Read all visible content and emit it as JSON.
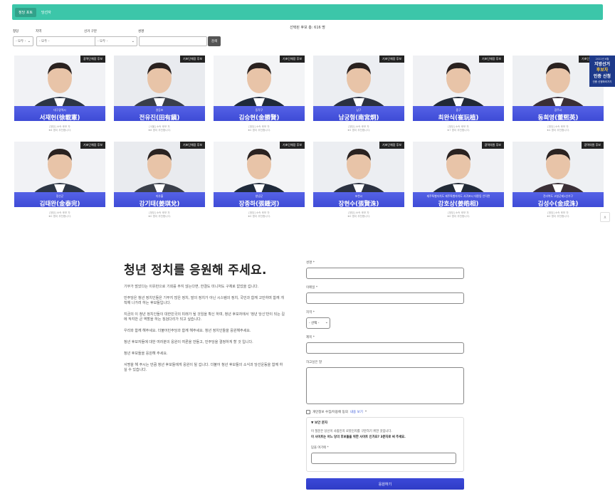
{
  "tabs": [
    {
      "label": "정당 포토",
      "active": true
    },
    {
      "label": "당선자",
      "active": false
    }
  ],
  "summary": "선택된 후보 총: 616 명",
  "filters": {
    "party_label": "정당",
    "region_label": "지역",
    "district_label": "선거 구분",
    "name_label": "성명",
    "party_value": "- 모두 -",
    "region_value": "- 모두 -",
    "district_value": "- 모두 -",
    "search_label": "검색"
  },
  "candidates": [
    {
      "badge": "광역단체장 후보",
      "region": "대구광역시",
      "name": "서재헌(徐載憲)",
      "meta1": "[정당] 소속 후보 자",
      "meta2": "★6 명이 추천합니다."
    },
    {
      "badge": "기초단체장 후보",
      "region": "영등포",
      "name": "전유진(田有鎭)",
      "meta1": "[서울] 소속 후보 자",
      "meta2": "★8 명이 추천합니다."
    },
    {
      "badge": "기초단체장 후보",
      "region": "동작구",
      "name": "김승현(金勝賢)",
      "meta1": "[정당] 소속 후보 자",
      "meta2": "★0 명이 추천합니다."
    },
    {
      "badge": "기초단체장 후보",
      "region": "남구",
      "name": "남궁형(南宮炯)",
      "meta1": "[정당] 소속 후보 자",
      "meta2": "★5 명이 추천합니다."
    },
    {
      "badge": "기초단체장 후보",
      "region": "중구",
      "name": "최완식(崔玩植)",
      "meta1": "[정당] 소속 후보 자",
      "meta2": "★7 명이 추천합니다."
    },
    {
      "badge": "기초단체장 후보",
      "region": "광주시",
      "name": "동희영(董熙英)",
      "meta1": "[정당] 소속 후보 자",
      "meta2": "★4 명이 추천합니다."
    },
    {
      "badge": "기초단체장 후보",
      "region": "정선군",
      "name": "김태완(金泰完)",
      "meta1": "[정당] 소속 후보 자",
      "meta2": "★0 명이 추천합니다."
    },
    {
      "badge": "기초단체장 후보",
      "region": "미추홀",
      "name": "강기태(姜琪兌)",
      "meta1": "[정당] 소속 후보 자",
      "meta2": "★0 명이 추천합니다."
    },
    {
      "badge": "기초단체장 후보",
      "region": "창녕군",
      "name": "장종하(張鍾河)",
      "meta1": "[정당] 소속 후보 자",
      "meta2": "★0 명이 추천합니다."
    },
    {
      "badge": "기초단체장 후보",
      "region": "포천시",
      "name": "장현수(張賢洙)",
      "meta1": "[정당] 소속 후보 자",
      "meta2": "★0 명이 추천합니다."
    },
    {
      "badge": "광역의원 후보",
      "region": "제주특별자치도 제주특별자치도 서귀포시 대륜동 안덕면",
      "name": "강호상(姜皓相)",
      "meta1": "[정당] 소속 후보 자",
      "meta2": "★0 명이 추천합니다."
    },
    {
      "badge": "광역의원 후보",
      "region": "전라북도 고창군제1선거구",
      "name": "김성수(金成洙)",
      "meta1": "[정당] 소속 후보 자",
      "meta2": "★0 명이 추천합니다."
    }
  ],
  "banner": {
    "top": "2022년 6월",
    "line1": "지방선거",
    "line2": "후보자",
    "line3": "인증 신청",
    "bottom": "인증 신청하러가기"
  },
  "scroll_top_label": "∧",
  "appeal": {
    "title": "청년 정치를 응원해 주세요.",
    "paragraphs": [
      "기부가 많았다는 이유만으로 기회를 주지 않는다면, 한결도 미니처도 구체로 없었을 겁니다.",
      "민주당은 청년 정치인들은 기부지 많은 정치, 말의 정치가 아닌 시스템의 정치, 국민과 함께 고민하며 함께 개척해 나가려 하는 후보들입니다.",
      "지금의 이 청년 정치인들이 대한민국의 미래가 될 것임을 확신 하며, 청년 후보자에서 '청년 당신'만이 되는 길에 작지만 큰 역할을 하는 징검다리가 되고 싶습니다.",
      "우리와 함께 해주세요. 더불어민주당과 함께 해주세요. 청년 정치인들을 응원해주세요.",
      "청년 후보자들에 대한 여러분의 응원이 여론을 만들고, 민주당을 결정하게 할 것 입니다.",
      "청년 후보들을 응원해 주세요.",
      "서명을 해 주시는 만큼 청년 후보들에게 응원이 될 겁니다. 더불어 청년 후보들의 소식과 당선운동을 함께 하실 수 있습니다."
    ]
  },
  "form": {
    "name_label": "성명 *",
    "email_label": "이메일 *",
    "region_label": "지역 *",
    "region_value": "- 선택 -",
    "title_label": "제목 *",
    "message_label": "하고싶은 말",
    "agree_text": "개인정보 수집/이용에 동의",
    "agree_link": "내용 보기",
    "agree_required": "*",
    "security_title": "▼ 보안 문자",
    "security_desc": "이 질문은 당신이 사람인지 로봇인지를 구분하기 위한 것입니다.",
    "security_question": "이 사이트는 어느 당의 후보들을 위한 사이트 인가요? 3문자로 써 주세요.",
    "answer_label": "답을 여기에 *",
    "submit_label": "응원하기"
  }
}
